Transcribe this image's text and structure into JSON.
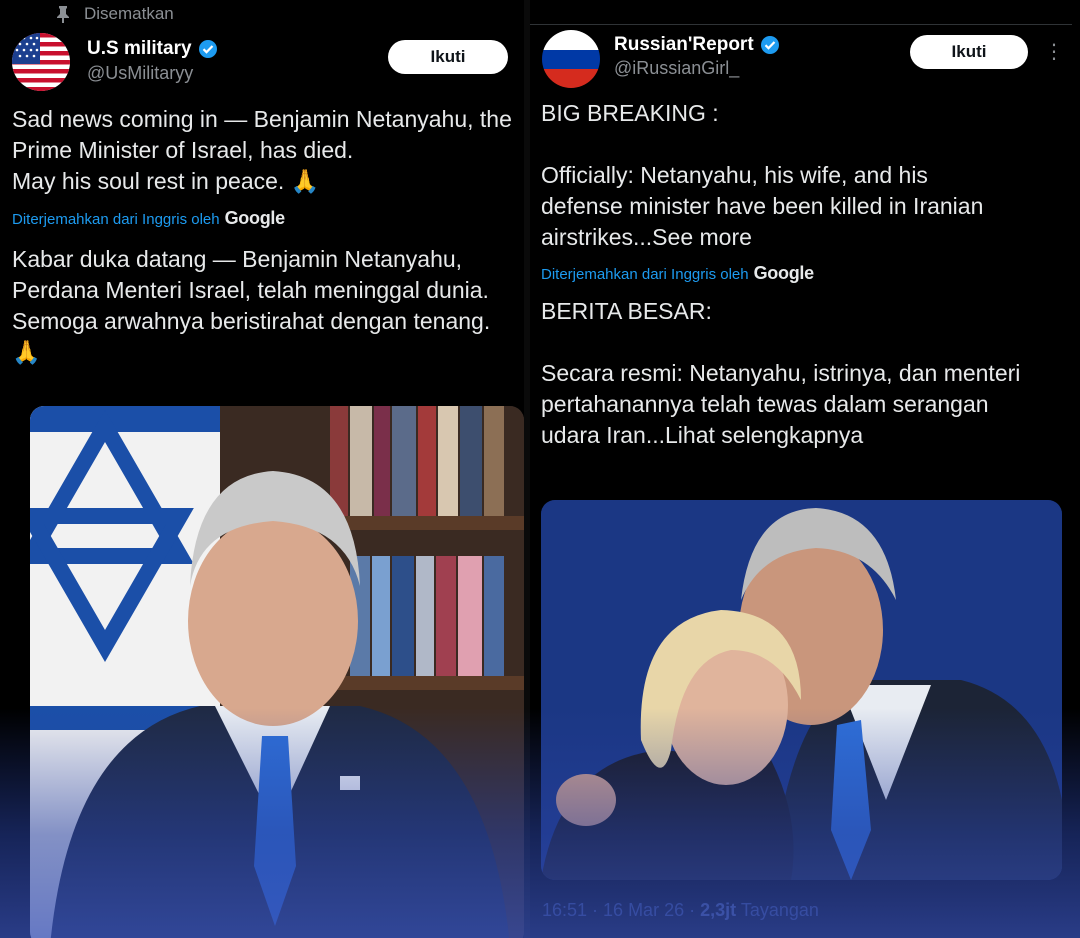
{
  "left_tweet": {
    "pinned_label": "Disematkan",
    "author_name": "U.S military",
    "author_handle": "@UsMilitaryy",
    "follow_label": "Ikuti",
    "text": "Sad news coming in — Benjamin Netanyahu, the\nPrime Minister of Israel, has died.\nMay his soul rest in peace. 🙏",
    "translated_label": "Diterjemahkan dari Inggris oleh",
    "translator": "Google",
    "translation": "Kabar duka datang — Benjamin Netanyahu,\nPerdana Menteri Israel, telah meninggal dunia.\nSemoga arwahnya beristirahat dengan tenang.\n🙏"
  },
  "right_tweet": {
    "author_name": "Russian'Report",
    "author_handle": "@iRussianGirl_",
    "follow_label": "Ikuti",
    "more_label": "⋮",
    "text": "BIG BREAKING :\n\nOfficially: Netanyahu, his wife, and his\ndefense minister have been killed in Iranian\nairstrikes...See more",
    "translated_label": "Diterjemahkan dari Inggris oleh",
    "translator": "Google",
    "translation": "BERITA BESAR:\n\nSecara resmi: Netanyahu, istrinya, dan menteri\npertahanannya telah tewas dalam serangan\nudara Iran...Lihat selengkapnya",
    "time": "16:51 · 16 Mar 26 ·",
    "views": "2,3jt",
    "views_label": "Tayangan"
  },
  "colors": {
    "background": "#000000",
    "link_blue": "#1d9bf0",
    "verified_blue": "#1d9bf0",
    "muted": "#8b8f94",
    "text": "#e7e9ea"
  }
}
